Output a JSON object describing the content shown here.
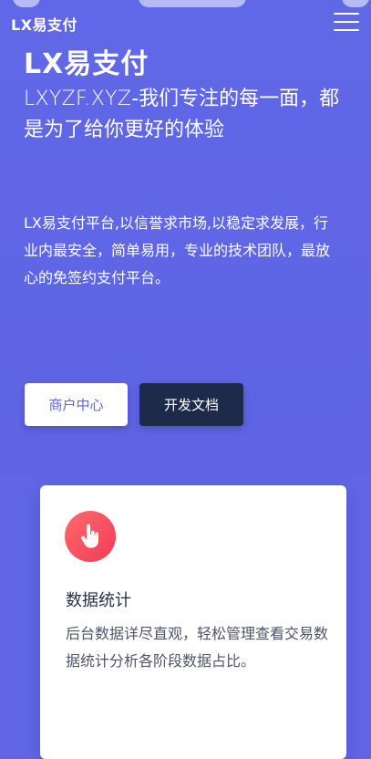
{
  "header": {
    "brand": "LX易支付"
  },
  "hero": {
    "title": "LX易支付",
    "subtitle_domain": "LXYZF.XYZ",
    "subtitle_text": "-我们专注的每一面，都是为了给你更好的体验",
    "description": "LX易支付平台,以信誉求市场,以稳定求发展，行业内最安全，简单易用，专业的技术团队，最放心的免签约支付平台。"
  },
  "buttons": {
    "merchant": "商户中心",
    "docs": "开发文档"
  },
  "feature_card": {
    "icon": "hand-pointer-icon",
    "title": "数据统计",
    "text": "后台数据详尽直观，轻松管理查看交易数据统计分析各阶段数据占比。"
  },
  "colors": {
    "background": "#6066e6",
    "docs_button": "#1e2a4a",
    "icon_gradient_start": "#ff6a6a",
    "icon_gradient_end": "#f23b5a"
  }
}
